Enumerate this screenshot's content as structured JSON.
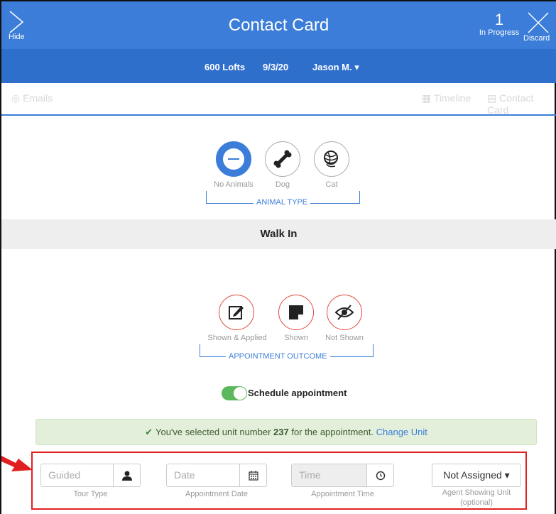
{
  "header": {
    "title": "Contact Card",
    "hide_label": "Hide",
    "in_progress_count": "1",
    "in_progress_label": "In Progress",
    "discard_label": "Discard"
  },
  "subheader": {
    "property": "600 Lofts",
    "date": "9/3/20",
    "agent": "Jason M. ▾"
  },
  "tabs": {
    "emails": "Emails",
    "timeline": "Timeline",
    "contact_card": "Contact Card"
  },
  "animal_type": {
    "caption": "Animal Type",
    "options": [
      {
        "label": "No Animals",
        "icon": "no-entry-icon",
        "selected": true
      },
      {
        "label": "Dog",
        "icon": "bone-icon",
        "selected": false
      },
      {
        "label": "Cat",
        "icon": "yarn-ball-icon",
        "selected": false
      }
    ]
  },
  "walk_in_title": "Walk In",
  "appointment_outcome": {
    "caption": "Appointment Outcome",
    "options": [
      {
        "label": "Shown & Applied",
        "icon": "edit-icon"
      },
      {
        "label": "Shown",
        "icon": "note-icon"
      },
      {
        "label": "Not Shown",
        "icon": "eye-slash-icon"
      }
    ]
  },
  "schedule_toggle": {
    "label": "Schedule appointment",
    "on": true
  },
  "alert": {
    "prefix": "You've selected unit number ",
    "unit": "237",
    "suffix": " for the appointment.",
    "link": "Change Unit"
  },
  "form": {
    "tour_type": {
      "placeholder": "Guided",
      "caption": "Tour Type"
    },
    "date": {
      "placeholder": "Date",
      "caption": "Appointment Date"
    },
    "time": {
      "placeholder": "Time",
      "caption": "Appointment Time"
    },
    "agent": {
      "value": "Not Assigned ▾",
      "caption_line1": "Agent Showing Unit",
      "caption_line2": "(optional)"
    }
  },
  "colors": {
    "header_blue": "#3b7dd8",
    "outcome_red": "#e04b3c",
    "toggle_green": "#5cb85c",
    "alert_bg": "#e3efda",
    "highlight_red": "#e02020"
  }
}
